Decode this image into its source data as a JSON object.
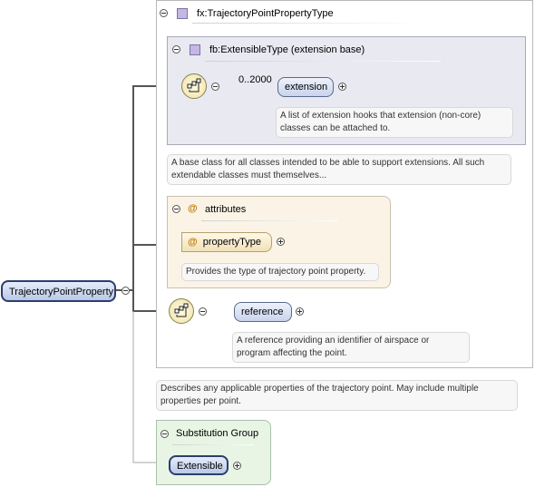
{
  "complex_type": {
    "name": "fx:TrajectoryPointPropertyType",
    "extension_base": {
      "name": "fb:ExtensibleType (extension base)",
      "element": {
        "name": "extension",
        "occurrence": "0..2000",
        "doc": "A list of extension hooks that extension (non-core) classes can be attached to."
      },
      "doc": "A base class for all classes intended to be able to support extensions. All such extendable classes must themselves..."
    },
    "attributes": {
      "title": "attributes",
      "items": [
        {
          "name": "propertyType",
          "doc": "Provides the type of trajectory point property."
        }
      ]
    },
    "reference": {
      "name": "reference",
      "doc": "A reference providing an identifier of airspace or program affecting the point."
    }
  },
  "root_element": {
    "name": "TrajectoryPointProperty",
    "doc": "Describes any applicable properties of the trajectory point. May include multiple properties per point."
  },
  "substitution_group": {
    "title": "Substitution Group",
    "member": "Extensible"
  },
  "colors": {
    "element_fill": "#c8d4ec",
    "type_panel_fill": "#e9e9f1",
    "attributes_fill": "#fbf4e6",
    "substitution_fill": "#e8f5e4",
    "connector": "#555555"
  }
}
